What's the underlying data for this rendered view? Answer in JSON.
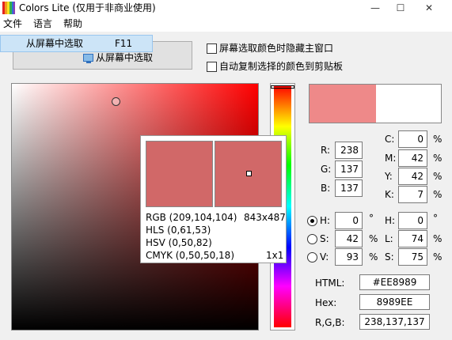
{
  "window": {
    "title": "Colors Lite (仅用于非商业使用)"
  },
  "menubar": {
    "file": "文件",
    "language": "语言",
    "help": "帮助"
  },
  "dropdown": {
    "item_label": "从屏幕中选取",
    "item_shortcut": "F11"
  },
  "toolbar": {
    "screen_pick_label": "从屏幕中选取"
  },
  "options": {
    "hide_window_label": "屏幕选取颜色时隐藏主窗口",
    "auto_copy_label": "自动复制选择的颜色到剪贴板"
  },
  "magnifier": {
    "rgb": "RGB (209,104,104)",
    "hls": "HLS (0,61,53)",
    "hsv": "HSV (0,50,82)",
    "cmyk": "CMYK (0,50,50,18)",
    "screen_coords": "843x487",
    "zoom_level": "1x1"
  },
  "preview": {
    "color": "#EE8989"
  },
  "rgb": {
    "r_label": "R:",
    "r_value": "238",
    "g_label": "G:",
    "g_value": "137",
    "b_label": "B:",
    "b_value": "137"
  },
  "cmyk": {
    "c_label": "C:",
    "c_value": "0",
    "m_label": "M:",
    "m_value": "42",
    "y_label": "Y:",
    "y_value": "42",
    "k_label": "K:",
    "k_value": "7",
    "unit": "%"
  },
  "hsv": {
    "h_label": "H:",
    "h_value": "0",
    "h_unit": "°",
    "s_label": "S:",
    "s_value": "42",
    "s_unit": "%",
    "v_label": "V:",
    "v_value": "93",
    "v_unit": "%",
    "selected": "H"
  },
  "hls": {
    "h_label": "H:",
    "h_value": "0",
    "h_unit": "°",
    "l_label": "L:",
    "l_value": "74",
    "l_unit": "%",
    "s_label": "S:",
    "s_value": "75",
    "s_unit": "%"
  },
  "codes": {
    "html_label": "HTML:",
    "html_value": "#EE8989",
    "hex_label": "Hex:",
    "hex_value": "8989EE",
    "rgb_label": "R,G,B:",
    "rgb_value": "238,137,137"
  }
}
